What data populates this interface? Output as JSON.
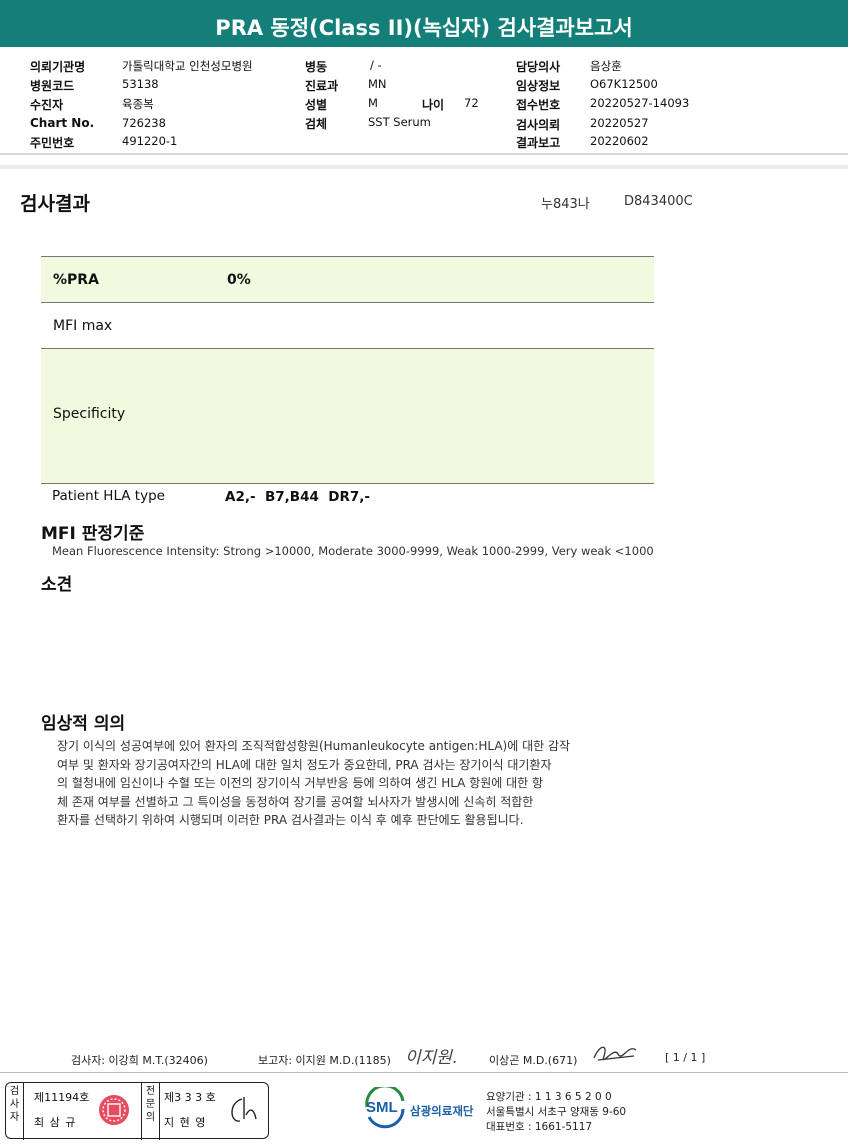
{
  "title": "PRA 동정(Class II)(녹십자) 검사결과보고서",
  "patient": {
    "col1": [
      {
        "label": "의뢰기관명",
        "value": "가톨릭대학교 인천성모병원"
      },
      {
        "label": "병원코드",
        "value": "53138"
      },
      {
        "label": "수진자",
        "value": "육종복"
      },
      {
        "label": "Chart No.",
        "value": "726238"
      },
      {
        "label": "주민번호",
        "value": "491220-1"
      }
    ],
    "col2": [
      {
        "label": "병동",
        "value": "/ -"
      },
      {
        "label": "진료과",
        "value": "MN"
      },
      {
        "label": "성별",
        "value": "M"
      },
      {
        "label": "검체",
        "value": "SST Serum"
      }
    ],
    "age": {
      "label": "나이",
      "value": "72"
    },
    "col3": [
      {
        "label": "담당의사",
        "value": "음상훈"
      },
      {
        "label": "임상정보",
        "value": "O67K12500"
      },
      {
        "label": "접수번호",
        "value": "20220527-14093"
      },
      {
        "label": "검사의뢰",
        "value": "20220527"
      },
      {
        "label": "결과보고",
        "value": "20220602"
      }
    ]
  },
  "results": {
    "heading": "검사결과",
    "code1": "누843나",
    "code2": "D843400C",
    "pra_label": "%PRA",
    "pra_value": "0%",
    "mfi_label": "MFI max",
    "mfi_value": "",
    "specificity_label": "Specificity",
    "specificity_value": "",
    "hla_label": "Patient HLA type",
    "hla_value": "A2,-  B7,B44  DR7,-"
  },
  "criteria": {
    "heading": "MFI 판정기준",
    "text": "Mean Fluorescence Intensity: Strong >10000, Moderate 3000-9999, Weak 1000-2999, Very weak <1000"
  },
  "findings": {
    "heading": "소견",
    "text": ""
  },
  "clinical": {
    "heading": "임상적 의의",
    "lines": [
      "장기 이식의 성공여부에 있어 환자의 조직적합성항원(Humanleukocyte antigen:HLA)에 대한 감작",
      "여부 및 환자와 장기공여자간의 HLA에 대한 일치 정도가 중요한데, PRA 검사는 장기이식 대기환자",
      "의 혈청내에 임신이나 수혈 또는 이전의 장기이식 거부반응 등에 의하여 생긴 HLA 항원에 대한 항",
      "체 존재 여부를 선별하고 그 특이성을 동정하여 장기를 공여할 뇌사자가 발생시에 신속히 적합한",
      "환자를 선택하기 위하여 시행되며 이러한 PRA 검사결과는 이식 후 예후 판단에도 활용됩니다."
    ]
  },
  "signatures": {
    "tester": "검사자: 이강희 M.T.(32406)",
    "reporter": "보고자: 이지원 M.D.(1185)",
    "reporter_sign": "이지원.",
    "doctor": "이상곤 M.D.(671)",
    "page": "[ 1 / 1 ]"
  },
  "footer": {
    "box1_label": "검사자",
    "box1_no": "제11194호",
    "box1_name": "최 삼 규",
    "box2_label": "전문의",
    "box2_no": "제3 3 3 호",
    "box2_name": "지 현 영",
    "logo_text": "SML",
    "org_name": "삼광의료재단",
    "info1": "요양기관 : 1 1 3 6 5 2 0 0",
    "info2": "서울특별시 서초구 양재동 9-60",
    "info3": "대표번호 : 1661-5117"
  },
  "colors": {
    "title_bg": "#137f78",
    "highlight": "#f1fadf",
    "logo_blue": "#1a5fa8",
    "logo_green": "#2b8a3e"
  }
}
